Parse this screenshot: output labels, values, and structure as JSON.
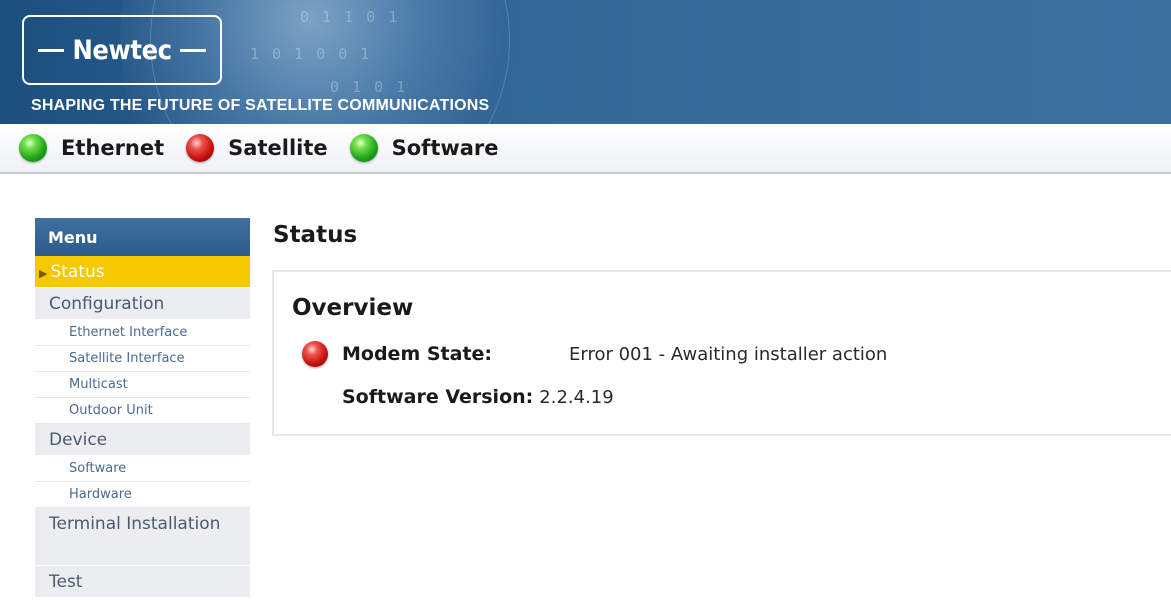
{
  "header": {
    "logo_text": "Newtec",
    "tagline": "SHAPING THE FUTURE OF SATELLITE COMMUNICATIONS"
  },
  "indicators": [
    {
      "label": "Ethernet",
      "status": "green"
    },
    {
      "label": "Satellite",
      "status": "red"
    },
    {
      "label": "Software",
      "status": "green"
    }
  ],
  "menu": {
    "title": "Menu",
    "items": [
      {
        "label": "Status",
        "active": true
      },
      {
        "label": "Configuration"
      },
      {
        "label": "Ethernet Interface",
        "sub": true
      },
      {
        "label": "Satellite Interface",
        "sub": true
      },
      {
        "label": "Multicast",
        "sub": true
      },
      {
        "label": "Outdoor Unit",
        "sub": true
      },
      {
        "label": "Device"
      },
      {
        "label": "Software",
        "sub": true
      },
      {
        "label": "Hardware",
        "sub": true
      },
      {
        "label": "Terminal Installation"
      },
      {
        "label": "Test"
      }
    ]
  },
  "main": {
    "page_title": "Status",
    "overview": {
      "title": "Overview",
      "modem_state_label": "Modem State:",
      "modem_state_value": "Error 001 - Awaiting installer action",
      "modem_state_status": "red",
      "software_version_label": "Software Version:",
      "software_version_value": "2.2.4.19"
    }
  },
  "colors": {
    "banner_blue": "#2d6395",
    "menu_active": "#f6c800",
    "status_green": "#1fa51a",
    "status_red": "#c4100c"
  }
}
